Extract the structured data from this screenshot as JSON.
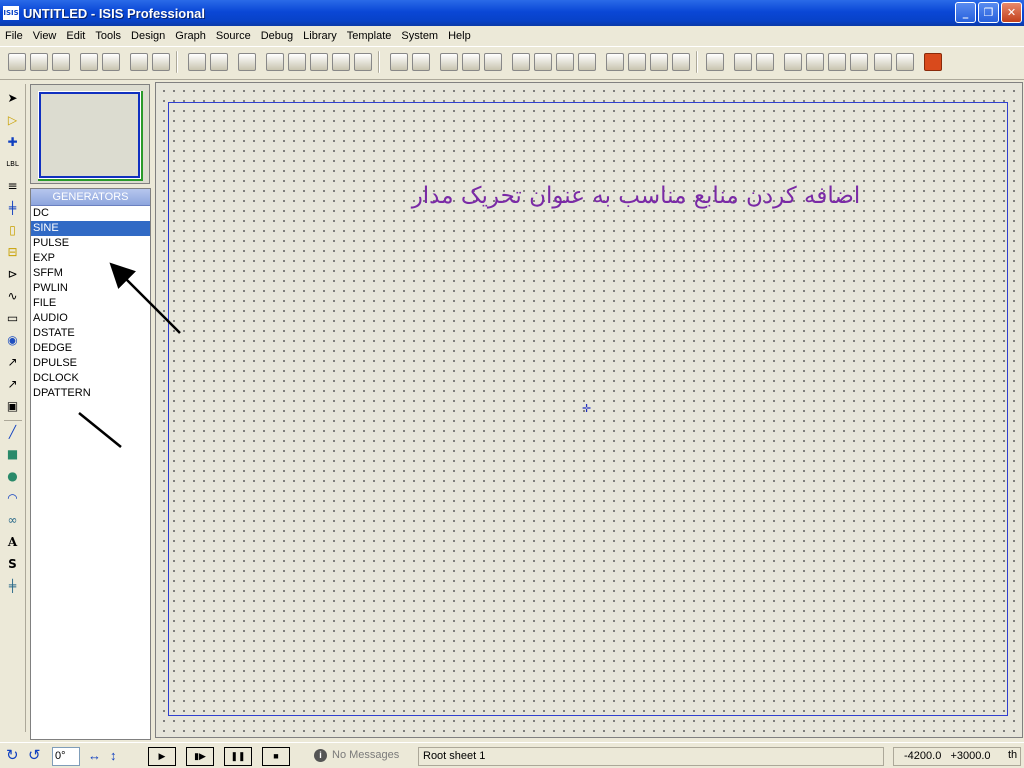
{
  "window": {
    "title": "UNTITLED - ISIS Professional",
    "logo": "ISIS"
  },
  "menu": [
    "File",
    "View",
    "Edit",
    "Tools",
    "Design",
    "Graph",
    "Source",
    "Debug",
    "Library",
    "Template",
    "System",
    "Help"
  ],
  "device_panel": {
    "header": "GENERATORS",
    "items": [
      "DC",
      "SINE",
      "PULSE",
      "EXP",
      "SFFM",
      "PWLIN",
      "FILE",
      "AUDIO",
      "DSTATE",
      "DEDGE",
      "DPULSE",
      "DCLOCK",
      "DPATTERN"
    ],
    "selected": "SINE"
  },
  "canvas": {
    "caption": "اضافه کردن منابع مناسب به عنوان تحریک مدار"
  },
  "status": {
    "rotation": "0°",
    "messages": "No Messages",
    "sheet": "Root sheet 1",
    "coords": "-4200.0   +3000.0",
    "units": "th"
  },
  "colors": {
    "selection": "#316ac5",
    "sheet_border": "#3040d0",
    "caption": "#7a2aa6",
    "arrow": "#000000"
  }
}
